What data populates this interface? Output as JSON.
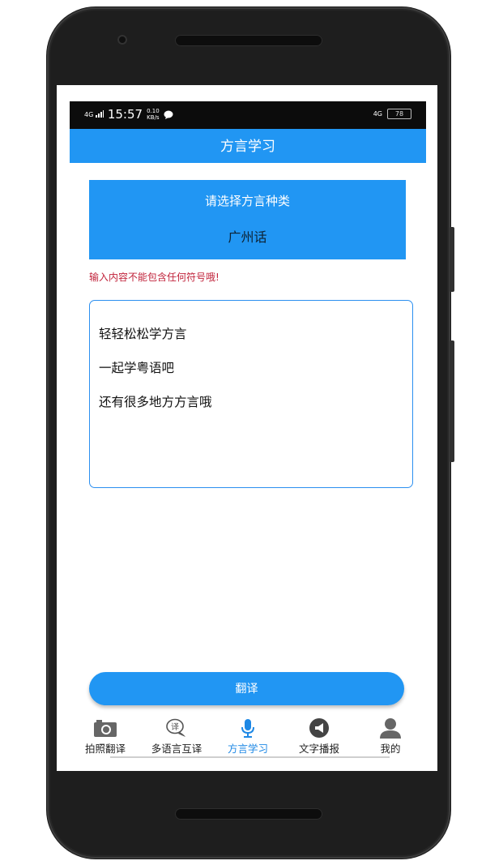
{
  "status_bar": {
    "signal_left": "4G",
    "time": "15:57",
    "net_speed_top": "0.10",
    "net_speed_bottom": "KB/s",
    "signal_right": "4G",
    "battery": "78"
  },
  "header": {
    "title": "方言学习"
  },
  "dialect_selector": {
    "title": "请选择方言种类",
    "value": "广州话"
  },
  "warning_text": "输入内容不能包含任何符号哦!",
  "input_area": {
    "lines": [
      "轻轻松松学方言",
      "一起学粤语吧",
      "还有很多地方方言哦"
    ]
  },
  "translate_button": {
    "label": "翻译"
  },
  "bottom_nav": {
    "active_index": 2,
    "items": [
      {
        "label": "拍照翻译",
        "icon": "camera-icon"
      },
      {
        "label": "多语言互译",
        "icon": "translate-bubble-icon"
      },
      {
        "label": "方言学习",
        "icon": "microphone-icon"
      },
      {
        "label": "文字播报",
        "icon": "megaphone-icon"
      },
      {
        "label": "我的",
        "icon": "user-icon"
      }
    ]
  },
  "colors": {
    "primary": "#2196f3",
    "warning": "#c0223a",
    "active_tab": "#1e88e5"
  }
}
